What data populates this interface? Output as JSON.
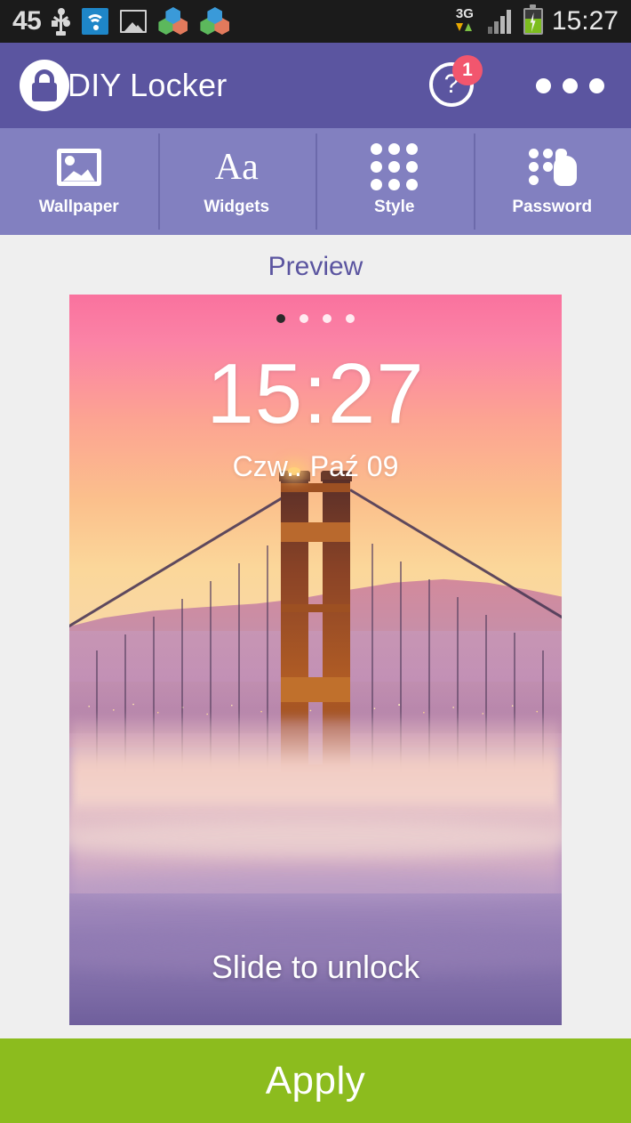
{
  "statusbar": {
    "battery_percent": "45",
    "network_type": "3G",
    "time": "15:27",
    "icons": [
      "usb-icon",
      "wifi-icon",
      "picture-icon",
      "hexagon-app-icon",
      "hexagon-app-icon",
      "data-transfer-icon",
      "signal-icon",
      "battery-charging-icon"
    ]
  },
  "appbar": {
    "title": "DIY Locker",
    "lock_icon": "lock-icon",
    "help_icon": "help-icon",
    "help_glyph": "?",
    "help_badge": "1",
    "overflow_icon": "overflow-menu-icon",
    "bg_color": "#5b55a0"
  },
  "tabs": [
    {
      "label": "Wallpaper",
      "icon": "image-icon"
    },
    {
      "label": "Widgets",
      "icon": "text-aa-icon",
      "glyph": "Aa"
    },
    {
      "label": "Style",
      "icon": "grid-dots-icon"
    },
    {
      "label": "Password",
      "icon": "keypad-touch-icon"
    }
  ],
  "preview": {
    "label": "Preview",
    "page_dots": {
      "count": 4,
      "active_index": 0
    },
    "clock": "15:27",
    "date": "Czw.. Paź 09",
    "slide_text": "Slide to unlock",
    "wallpaper_name": "golden-gate-bridge-sunset"
  },
  "footer": {
    "apply_label": "Apply",
    "apply_color": "#8cbc1e"
  }
}
